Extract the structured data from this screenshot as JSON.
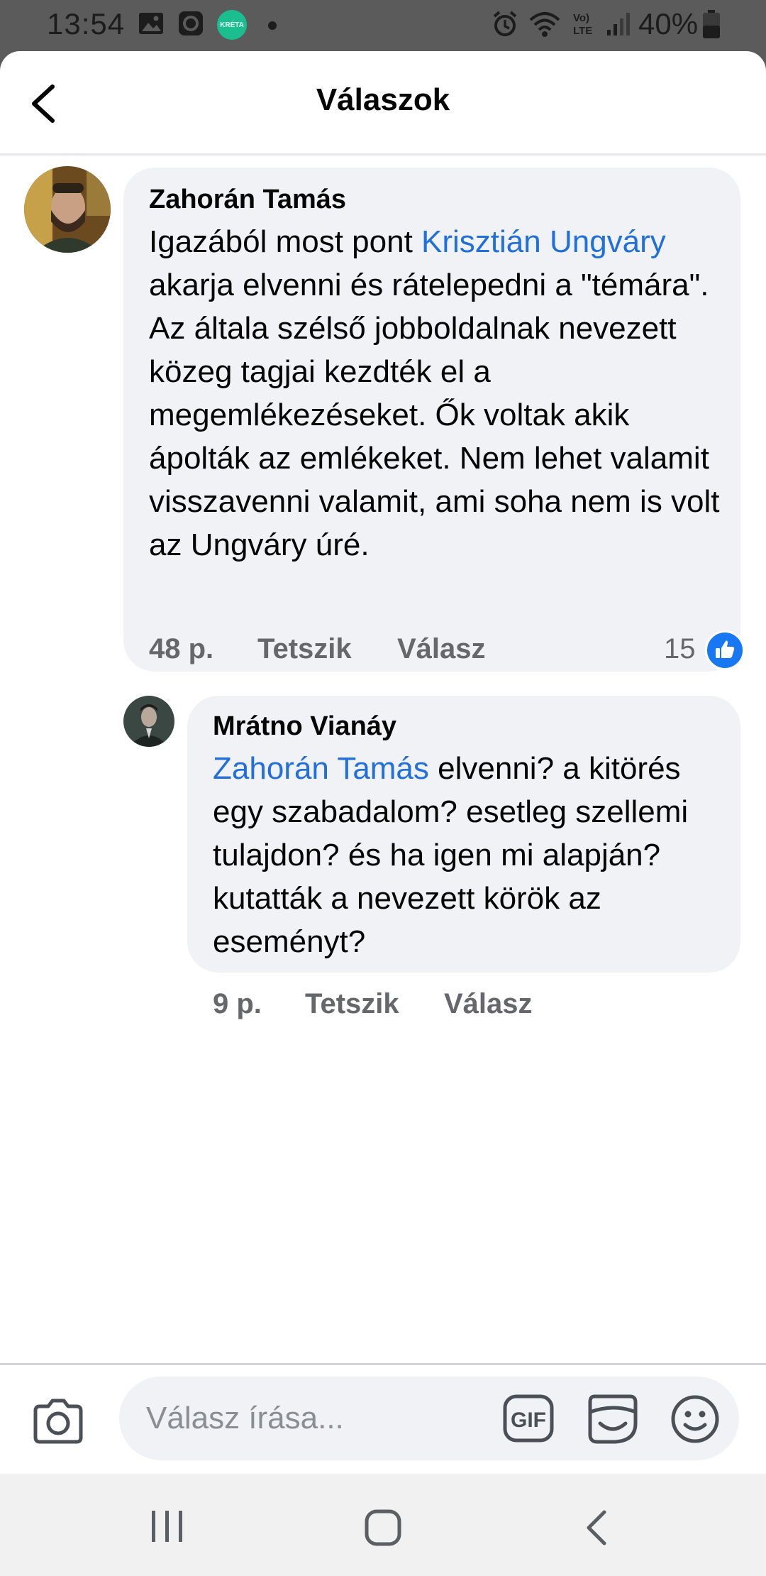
{
  "status_bar": {
    "time": "13:54",
    "app_badge_text": "KRÉTA",
    "battery": "40%",
    "network_label": "Vo) LTE"
  },
  "header": {
    "title": "Válaszok",
    "back_icon": "chevron-left-icon"
  },
  "comments": [
    {
      "author": "Zahorán Tamás",
      "body_before": "Igazából most pont ",
      "mention": "Krisztián Ungváry",
      "body_after": " akarja elvenni és rátelepedni a \"témára\". Az általa szélső jobboldalnak nevezett közeg tagjai kezdték el a megemlékezéseket. Ők voltak akik ápolták az emlékeket. Nem lehet valamit visszavenni valamit, ami soha nem is volt az Ungváry úré.",
      "time": "48 p.",
      "like_label": "Tetszik",
      "reply_label": "Válasz",
      "like_count": "15"
    },
    {
      "author": "Mrátno Vianáy",
      "mention": "Zahorán Tamás",
      "body_after": " elvenni? a kitörés egy szabadalom? esetleg szellemi tulajdon? és ha igen mi alapján? kutatták a nevezett körök az eseményt?",
      "time": "9 p.",
      "like_label": "Tetszik",
      "reply_label": "Válasz"
    }
  ],
  "composer": {
    "placeholder": "Válasz írása...",
    "gif_label": "GIF"
  },
  "colors": {
    "mention": "#216fdb",
    "bubble": "#f0f2f5",
    "like_badge": "#1877f2",
    "meta": "#65676b"
  }
}
